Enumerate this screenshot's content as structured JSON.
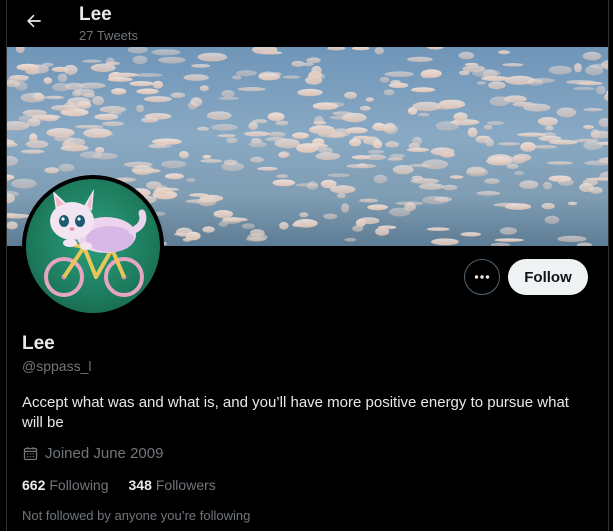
{
  "header": {
    "title": "Lee",
    "tweet_count": "27 Tweets",
    "back_icon": "arrow-left-icon"
  },
  "banner": {
    "description_icon": "sky-clouds-banner"
  },
  "avatar": {
    "icon": "cat-on-bicycle-avatar"
  },
  "actions": {
    "more_icon": "more-dots-icon",
    "follow_label": "Follow"
  },
  "profile": {
    "name": "Lee",
    "handle": "@sppass_l",
    "bio": "Accept what was and what is, and you’ll have more positive energy to pursue what will be",
    "joined": "Joined June 2009",
    "calendar_icon": "calendar-icon"
  },
  "stats": {
    "following_count": "662",
    "following_label": "Following",
    "followers_count": "348",
    "followers_label": "Followers"
  },
  "followed_note": "Not followed by anyone you’re following",
  "colors": {
    "background": "#000000",
    "primary_text": "#e7e9ea",
    "secondary_text": "#71767b",
    "follow_button_bg": "#eff3f4",
    "follow_button_text": "#0f1419",
    "border": "#2f3336"
  }
}
